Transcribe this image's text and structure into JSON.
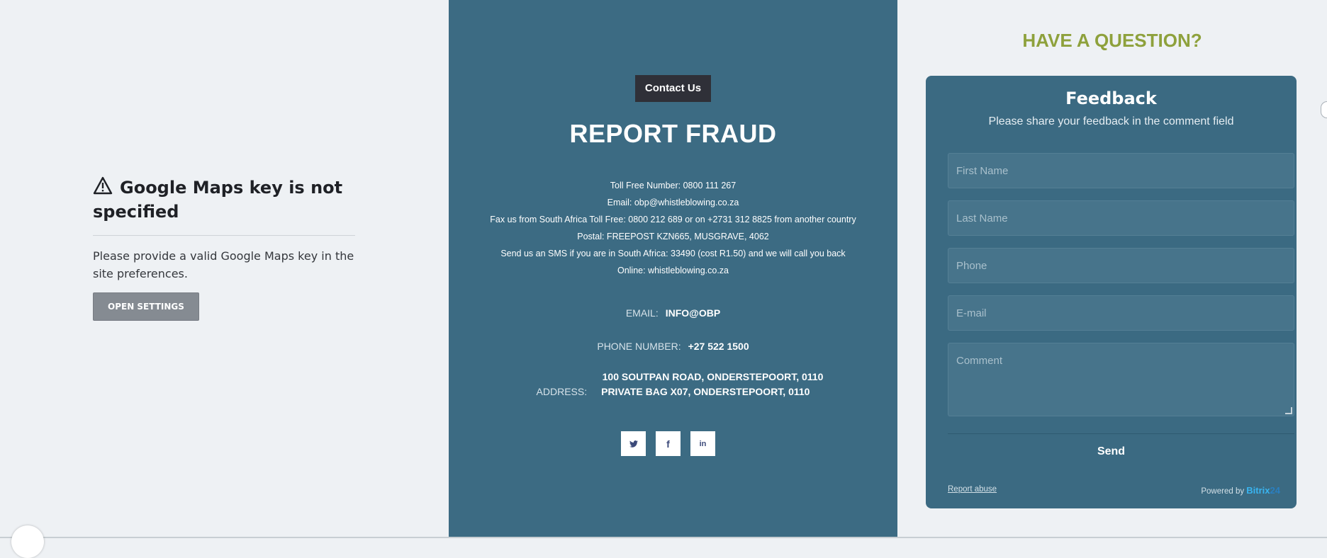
{
  "maps_notice": {
    "title": "Google Maps key is not specified",
    "message": "Please provide a valid Google Maps key in the site preferences.",
    "button": "OPEN SETTINGS"
  },
  "report": {
    "contact_button": "Contact Us",
    "title": "REPORT FRAUD",
    "lines": [
      "Toll Free Number: 0800 111 267",
      "Email: obp@whistleblowing.co.za",
      "Fax us from South Africa Toll Free: 0800 212 689 or on +2731 312 8825 from another country",
      "Postal: FREEPOST KZN665, MUSGRAVE, 4062",
      "Send us an SMS if you are in South Africa: 33490 (cost R1.50) and we will call you back",
      "Online: whistleblowing.co.za"
    ],
    "email_label": "EMAIL:",
    "email_value": "INFO@OBP",
    "phone_label": "PHONE NUMBER:",
    "phone_value": "+27 522 1500",
    "address_line1": "100 SOUTPAN ROAD, ONDERSTEPOORT, 0110",
    "address_label": "ADDRESS:",
    "address_line2": "PRIVATE BAG X07, ONDERSTEPOORT, 0110",
    "socials": [
      {
        "icon": "twitter-icon",
        "glyph": "🐦"
      },
      {
        "icon": "facebook-icon",
        "glyph": "f"
      },
      {
        "icon": "linkedin-icon",
        "glyph": "in"
      }
    ]
  },
  "feedback": {
    "question": "HAVE A QUESTION?",
    "title": "Feedback",
    "subtitle": "Please share your feedback in the comment field",
    "placeholders": {
      "first_name": "First Name",
      "last_name": "Last Name",
      "phone": "Phone",
      "email": "E-mail",
      "comment": "Comment"
    },
    "send": "Send",
    "report_abuse": "Report abuse",
    "powered_by": "Powered by",
    "brand": "Bitrix",
    "brand_num": "24"
  },
  "colors": {
    "center_bg": "#3c6b83",
    "question": "#8ea13c",
    "card_bg": "#3b6a82",
    "brand": "#39b4f0"
  }
}
